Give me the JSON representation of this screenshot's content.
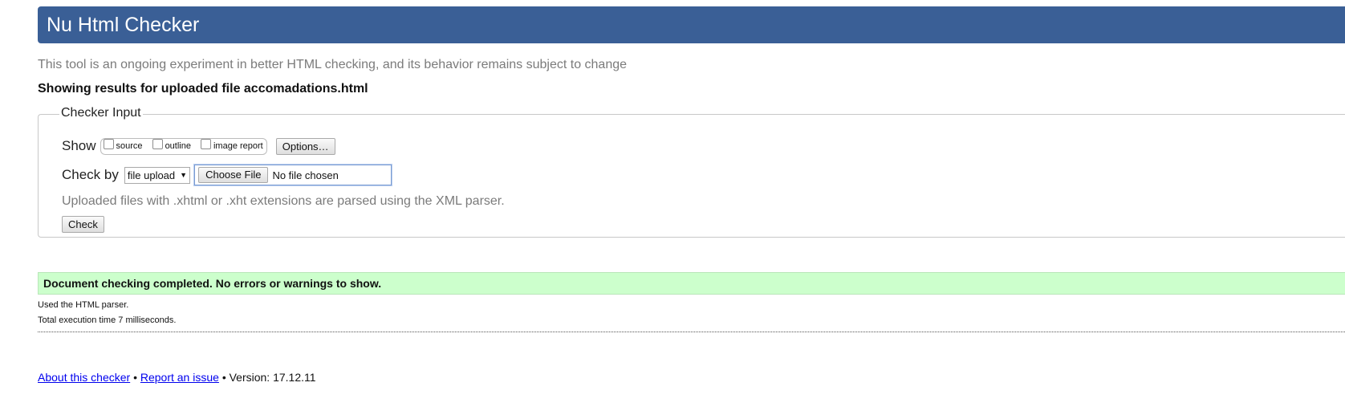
{
  "header": {
    "title": "Nu Html Checker"
  },
  "intro": "This tool is an ongoing experiment in better HTML checking, and its behavior remains subject to change",
  "showing_results": "Showing results for uploaded file accomadations.html",
  "checker_input": {
    "legend": "Checker Input",
    "show_label": "Show",
    "show_options": [
      {
        "label": "source",
        "checked": false
      },
      {
        "label": "outline",
        "checked": false
      },
      {
        "label": "image report",
        "checked": false
      }
    ],
    "options_button": "Options…",
    "check_by_label": "Check by",
    "check_by_selected": "file upload",
    "choose_file_button": "Choose File",
    "no_file_text": "No file chosen",
    "xml_note": "Uploaded files with .xhtml or .xht extensions are parsed using the XML parser.",
    "check_button": "Check"
  },
  "result": {
    "success_message": "Document checking completed. No errors or warnings to show.",
    "parser_text": "Used the HTML parser.",
    "execution_time": "Total execution time 7 milliseconds."
  },
  "footer": {
    "about_link": "About this checker",
    "separator": "•",
    "report_link": "Report an issue",
    "version_text": "Version: 17.12.11"
  },
  "colors": {
    "header_bg": "#3a5f96",
    "success_bg": "#ccffcc",
    "link": "#0000ee"
  }
}
